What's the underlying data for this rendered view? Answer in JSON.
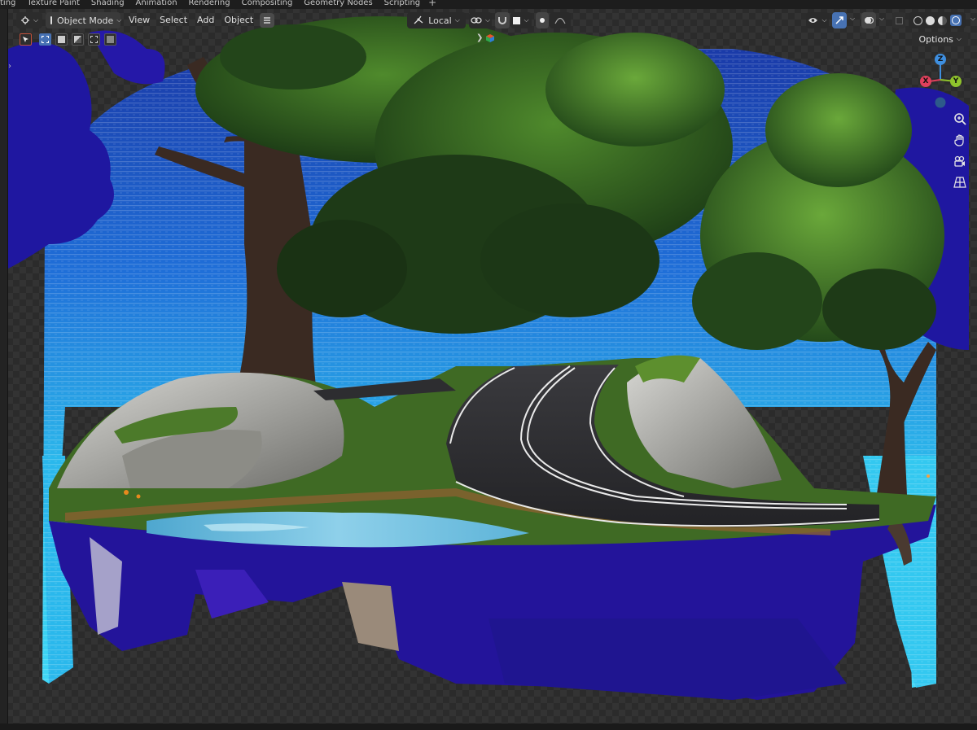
{
  "workspace_tabs": [
    "ting",
    "Texture Paint",
    "Shading",
    "Animation",
    "Rendering",
    "Compositing",
    "Geometry Nodes",
    "Scripting"
  ],
  "workspace_add": "+",
  "header": {
    "editor_type_icon": "viewport-icon",
    "mode": "Object Mode",
    "menus": [
      "View",
      "Select",
      "Add",
      "Object"
    ],
    "pivot": "Local",
    "options_label": "Options"
  },
  "gizmo": {
    "x": "X",
    "y": "Y",
    "z": "Z"
  },
  "nav_tools": [
    "zoom-icon",
    "hand-pan-icon",
    "camera-view-icon",
    "grid-perspective-icon"
  ],
  "colors": {
    "header_bg": "#1d1d1d",
    "accent": "#4772b3",
    "axis_x": "#e0405c",
    "axis_y": "#8fc22c",
    "axis_z": "#3e8fe0",
    "sky_cyan": "#29c8ec"
  }
}
